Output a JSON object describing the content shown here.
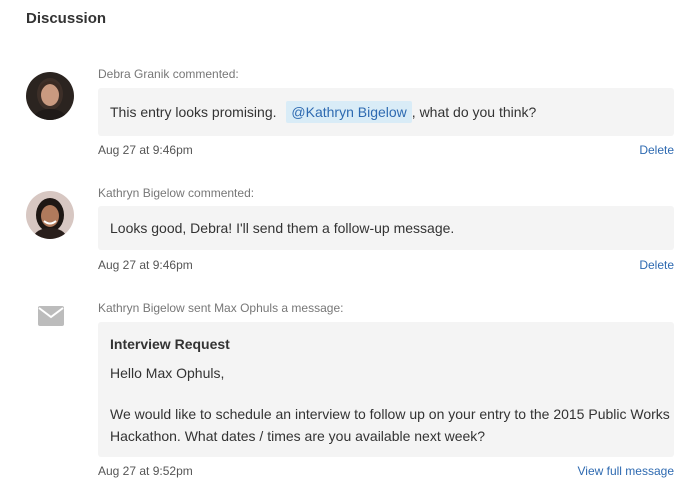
{
  "discussion": {
    "title": "Discussion",
    "comments": [
      {
        "author_line": "Debra Granik commented:",
        "text_before": "This entry looks promising.",
        "mention": "@Kathryn Bigelow",
        "text_after": ", what do you think?",
        "timestamp": "Aug 27 at 9:46pm",
        "action": "Delete"
      },
      {
        "author_line": "Kathryn Bigelow commented:",
        "text": "Looks good, Debra! I'll send them a follow-up message.",
        "timestamp": "Aug 27 at 9:46pm",
        "action": "Delete"
      }
    ],
    "message": {
      "author_line": "Kathryn Bigelow sent Max Ophuls a message:",
      "subject": "Interview Request",
      "greeting": "Hello Max Ophuls,",
      "body_line1": "We would like to schedule an interview to follow up on your entry to the 2015 Public Works",
      "body_line2": "Hackathon. What dates / times are you available next week?",
      "timestamp": "Aug 27 at 9:52pm",
      "action": "View full message"
    }
  },
  "colors": {
    "link": "#2e6ab1",
    "bubble_bg": "#f4f4f4",
    "mention_bg": "#d9ecf7",
    "meta_text": "#777777"
  },
  "icons": {
    "message_icon": "envelope-icon"
  }
}
